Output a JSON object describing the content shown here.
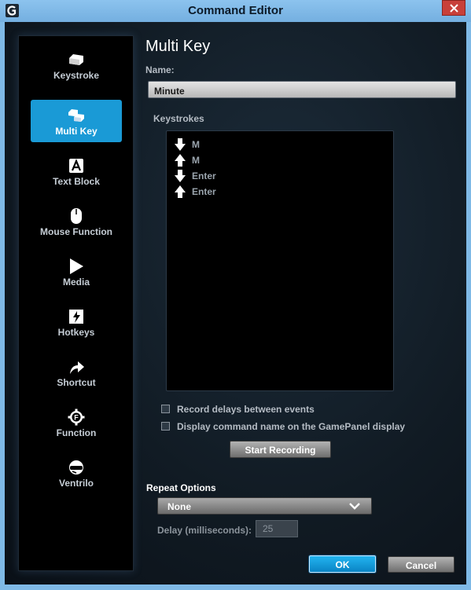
{
  "window": {
    "title": "Command Editor"
  },
  "sidebar": {
    "items": [
      {
        "label": "Keystroke",
        "icon": "keystroke-icon",
        "active": false
      },
      {
        "label": "Multi Key",
        "icon": "multi-key-icon",
        "active": true
      },
      {
        "label": "Text Block",
        "icon": "text-block-icon",
        "active": false
      },
      {
        "label": "Mouse Function",
        "icon": "mouse-icon",
        "active": false
      },
      {
        "label": "Media",
        "icon": "play-icon",
        "active": false
      },
      {
        "label": "Hotkeys",
        "icon": "hotkeys-icon",
        "active": false
      },
      {
        "label": "Shortcut",
        "icon": "shortcut-arrow-icon",
        "active": false
      },
      {
        "label": "Function",
        "icon": "function-gear-icon",
        "active": false
      },
      {
        "label": "Ventrilo",
        "icon": "headset-icon",
        "active": false
      }
    ]
  },
  "main": {
    "heading": "Multi Key",
    "name_label": "Name:",
    "name_value": "Minute",
    "keystrokes_label": "Keystrokes",
    "keystrokes": [
      {
        "direction": "down",
        "key": "M"
      },
      {
        "direction": "up",
        "key": "M"
      },
      {
        "direction": "down",
        "key": "Enter"
      },
      {
        "direction": "up",
        "key": "Enter"
      }
    ],
    "record_delays_label": "Record delays between events",
    "display_name_label": "Display command name on the GamePanel display",
    "start_recording_label": "Start Recording",
    "repeat_options_label": "Repeat Options",
    "repeat_value": "None",
    "delay_label": "Delay (milliseconds):",
    "delay_value": "25",
    "ok_label": "OK",
    "cancel_label": "Cancel"
  },
  "colors": {
    "accent": "#1a9ad6",
    "titlebar": "#7fb9e6",
    "close": "#c8403a"
  }
}
